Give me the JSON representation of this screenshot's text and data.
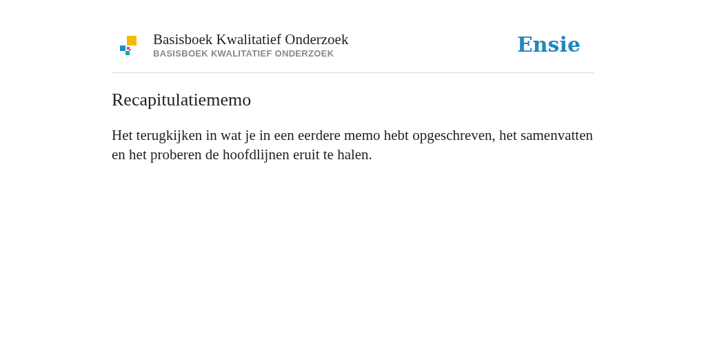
{
  "header": {
    "title": "Basisboek Kwalitatief Onderzoek",
    "subtitle": "BASISBOEK KWALITATIEF ONDERZOEK",
    "brand": "Ensie"
  },
  "entry": {
    "heading": "Recapitulatiememo",
    "body": "Het terugkijken in wat je in een eerdere memo hebt opgeschreven, het samenvatten en het proberen de hoofdlijnen eruit te halen."
  }
}
